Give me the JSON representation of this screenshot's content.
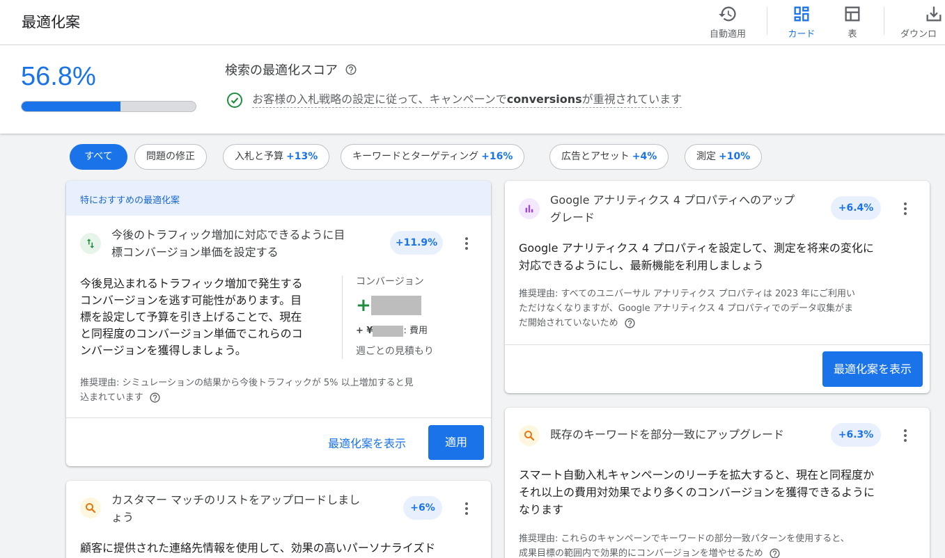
{
  "header": {
    "title": "最適化案",
    "tools": [
      {
        "label": "自動適用",
        "icon": "history-icon"
      },
      {
        "label": "カード",
        "icon": "dashboard-icon"
      },
      {
        "label": "表",
        "icon": "table-icon"
      },
      {
        "label": "ダウンロ",
        "icon": "download-icon"
      }
    ]
  },
  "score": {
    "value": "56.8%",
    "progress": 0.568,
    "title": "検索の最適化スコア",
    "message_pre": "お客様の入札戦略の設定に従って、キャンペーンで",
    "message_bold": "conversions",
    "message_post": "が重視されています"
  },
  "chips": [
    {
      "label": "すべて",
      "pct": ""
    },
    {
      "label": "問題の修正",
      "pct": ""
    },
    {
      "label": "入札と予算",
      "pct": "+13%"
    },
    {
      "label": "キーワードとターゲティング",
      "pct": "+16%"
    },
    {
      "label": "広告とアセット",
      "pct": "+4%"
    },
    {
      "label": "測定",
      "pct": "+10%"
    }
  ],
  "cards": {
    "tcpa": {
      "featured": "特におすすめの最適化案",
      "title_line1": "今後のトラフィック増加に対応できるように目",
      "title_line2": "標コンバージョン単価を設定する",
      "badge": "+11.9%",
      "desc_lines": [
        "今後見込まれるトラフィック増加で発生する",
        "コンバージョンを逃す可能性があります。目",
        "標を設定して予算を引き上げることで、現在",
        "と同程度のコンバージョン単価でこれらのコ",
        "ンバージョンを獲得しましょう。"
      ],
      "metric_label": "コンバージョン",
      "metric_plus": "+",
      "cost_prefix": "+ ¥",
      "cost_suffix": ": 費用",
      "estimate": "週ごとの見積もり",
      "reason_line1": "推奨理由: シミュレーションの結果から今後トラフィックが 5% 以上増加すると見",
      "reason_line2": "込まれています",
      "view_label": "最適化案を表示",
      "apply_label": "適用"
    },
    "customer_match": {
      "title_line1": "カスタマー マッチのリストをアップロードしまし",
      "title_line2": "ょう",
      "badge": "+6%",
      "desc_line1": "顧客に提供された連絡先情報を使用して、効果の高いパーソナライズド"
    },
    "ga4": {
      "title_line1": "Google アナリティクス 4 プロパティへのアップ",
      "title_line2": "グレード",
      "badge": "+6.4%",
      "desc_lines": [
        "Google アナリティクス 4 プロパティを設定して、測定を将来の変化に",
        "対応できるようにし、最新機能を利用しましょう"
      ],
      "reason_lines": [
        "推奨理由: すべてのユニバーサル アナリティクス プロパティは 2023 年にご利用い",
        "ただけなくなりますが、Google アナリティクス 4 プロパティでのデータ収集がま",
        "だ開始されていないため"
      ],
      "view_label": "最適化案を表示"
    },
    "broad_match": {
      "title": "既存のキーワードを部分一致にアップグレード",
      "badge": "+6.3%",
      "desc_lines": [
        "スマート自動入札キャンペーンのリーチを拡大すると、現在と同程度か",
        "それ以上の費用対効果でより多くのコンバージョンを獲得できるように",
        "なります"
      ],
      "reason_lines": [
        "推奨理由: これらのキャンペーンでキーワードの部分一致パターンを使用すると、",
        "成果目標の範囲内で効果的にコンバージョンを増やせるため"
      ]
    }
  },
  "colors": {
    "accent": "#1a73e8",
    "success": "#1e8e3e",
    "ga_purple": "#a142f4",
    "search_orange": "#e8710a"
  }
}
